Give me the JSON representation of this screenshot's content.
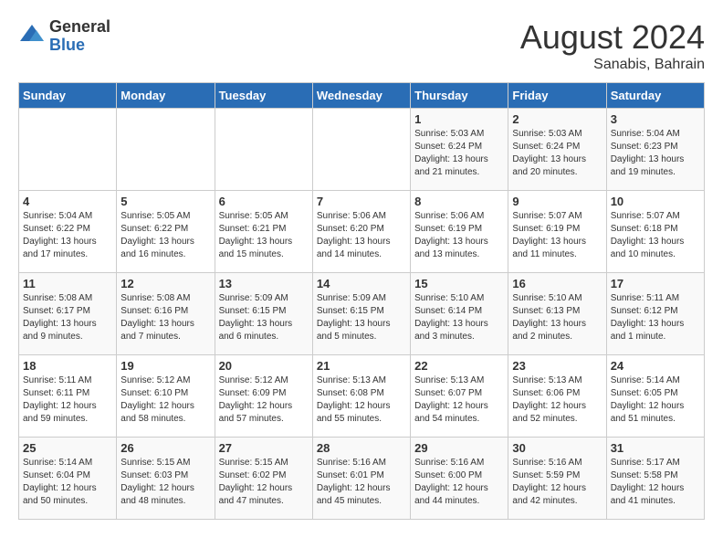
{
  "logo": {
    "general": "General",
    "blue": "Blue"
  },
  "title": {
    "month_year": "August 2024",
    "location": "Sanabis, Bahrain"
  },
  "weekdays": [
    "Sunday",
    "Monday",
    "Tuesday",
    "Wednesday",
    "Thursday",
    "Friday",
    "Saturday"
  ],
  "weeks": [
    [
      {
        "day": "",
        "info": ""
      },
      {
        "day": "",
        "info": ""
      },
      {
        "day": "",
        "info": ""
      },
      {
        "day": "",
        "info": ""
      },
      {
        "day": "1",
        "info": "Sunrise: 5:03 AM\nSunset: 6:24 PM\nDaylight: 13 hours\nand 21 minutes."
      },
      {
        "day": "2",
        "info": "Sunrise: 5:03 AM\nSunset: 6:24 PM\nDaylight: 13 hours\nand 20 minutes."
      },
      {
        "day": "3",
        "info": "Sunrise: 5:04 AM\nSunset: 6:23 PM\nDaylight: 13 hours\nand 19 minutes."
      }
    ],
    [
      {
        "day": "4",
        "info": "Sunrise: 5:04 AM\nSunset: 6:22 PM\nDaylight: 13 hours\nand 17 minutes."
      },
      {
        "day": "5",
        "info": "Sunrise: 5:05 AM\nSunset: 6:22 PM\nDaylight: 13 hours\nand 16 minutes."
      },
      {
        "day": "6",
        "info": "Sunrise: 5:05 AM\nSunset: 6:21 PM\nDaylight: 13 hours\nand 15 minutes."
      },
      {
        "day": "7",
        "info": "Sunrise: 5:06 AM\nSunset: 6:20 PM\nDaylight: 13 hours\nand 14 minutes."
      },
      {
        "day": "8",
        "info": "Sunrise: 5:06 AM\nSunset: 6:19 PM\nDaylight: 13 hours\nand 13 minutes."
      },
      {
        "day": "9",
        "info": "Sunrise: 5:07 AM\nSunset: 6:19 PM\nDaylight: 13 hours\nand 11 minutes."
      },
      {
        "day": "10",
        "info": "Sunrise: 5:07 AM\nSunset: 6:18 PM\nDaylight: 13 hours\nand 10 minutes."
      }
    ],
    [
      {
        "day": "11",
        "info": "Sunrise: 5:08 AM\nSunset: 6:17 PM\nDaylight: 13 hours\nand 9 minutes."
      },
      {
        "day": "12",
        "info": "Sunrise: 5:08 AM\nSunset: 6:16 PM\nDaylight: 13 hours\nand 7 minutes."
      },
      {
        "day": "13",
        "info": "Sunrise: 5:09 AM\nSunset: 6:15 PM\nDaylight: 13 hours\nand 6 minutes."
      },
      {
        "day": "14",
        "info": "Sunrise: 5:09 AM\nSunset: 6:15 PM\nDaylight: 13 hours\nand 5 minutes."
      },
      {
        "day": "15",
        "info": "Sunrise: 5:10 AM\nSunset: 6:14 PM\nDaylight: 13 hours\nand 3 minutes."
      },
      {
        "day": "16",
        "info": "Sunrise: 5:10 AM\nSunset: 6:13 PM\nDaylight: 13 hours\nand 2 minutes."
      },
      {
        "day": "17",
        "info": "Sunrise: 5:11 AM\nSunset: 6:12 PM\nDaylight: 13 hours\nand 1 minute."
      }
    ],
    [
      {
        "day": "18",
        "info": "Sunrise: 5:11 AM\nSunset: 6:11 PM\nDaylight: 12 hours\nand 59 minutes."
      },
      {
        "day": "19",
        "info": "Sunrise: 5:12 AM\nSunset: 6:10 PM\nDaylight: 12 hours\nand 58 minutes."
      },
      {
        "day": "20",
        "info": "Sunrise: 5:12 AM\nSunset: 6:09 PM\nDaylight: 12 hours\nand 57 minutes."
      },
      {
        "day": "21",
        "info": "Sunrise: 5:13 AM\nSunset: 6:08 PM\nDaylight: 12 hours\nand 55 minutes."
      },
      {
        "day": "22",
        "info": "Sunrise: 5:13 AM\nSunset: 6:07 PM\nDaylight: 12 hours\nand 54 minutes."
      },
      {
        "day": "23",
        "info": "Sunrise: 5:13 AM\nSunset: 6:06 PM\nDaylight: 12 hours\nand 52 minutes."
      },
      {
        "day": "24",
        "info": "Sunrise: 5:14 AM\nSunset: 6:05 PM\nDaylight: 12 hours\nand 51 minutes."
      }
    ],
    [
      {
        "day": "25",
        "info": "Sunrise: 5:14 AM\nSunset: 6:04 PM\nDaylight: 12 hours\nand 50 minutes."
      },
      {
        "day": "26",
        "info": "Sunrise: 5:15 AM\nSunset: 6:03 PM\nDaylight: 12 hours\nand 48 minutes."
      },
      {
        "day": "27",
        "info": "Sunrise: 5:15 AM\nSunset: 6:02 PM\nDaylight: 12 hours\nand 47 minutes."
      },
      {
        "day": "28",
        "info": "Sunrise: 5:16 AM\nSunset: 6:01 PM\nDaylight: 12 hours\nand 45 minutes."
      },
      {
        "day": "29",
        "info": "Sunrise: 5:16 AM\nSunset: 6:00 PM\nDaylight: 12 hours\nand 44 minutes."
      },
      {
        "day": "30",
        "info": "Sunrise: 5:16 AM\nSunset: 5:59 PM\nDaylight: 12 hours\nand 42 minutes."
      },
      {
        "day": "31",
        "info": "Sunrise: 5:17 AM\nSunset: 5:58 PM\nDaylight: 12 hours\nand 41 minutes."
      }
    ]
  ]
}
